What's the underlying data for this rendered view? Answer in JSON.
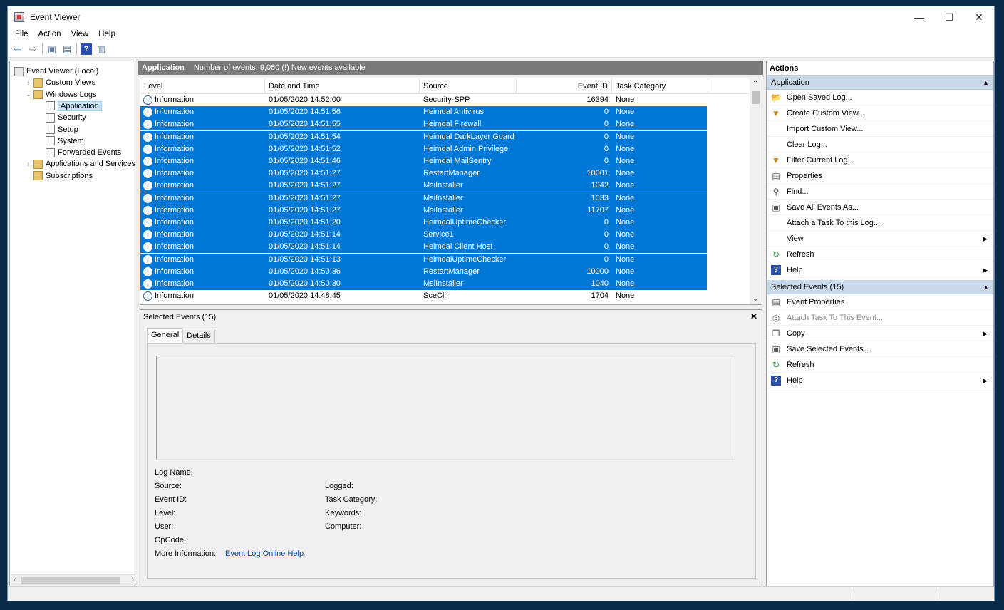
{
  "window": {
    "title": "Event Viewer",
    "controls": {
      "minimize": "—",
      "maximize": "☐",
      "close": "✕"
    }
  },
  "menu": [
    "File",
    "Action",
    "View",
    "Help"
  ],
  "toolbar": {
    "buttons": [
      {
        "name": "back-icon",
        "glyph": "⇦"
      },
      {
        "name": "forward-icon",
        "glyph": "⇨"
      },
      {
        "name": "up-folder-icon",
        "glyph": "▣"
      },
      {
        "name": "show-hide-tree-icon",
        "glyph": "▤"
      },
      {
        "name": "help-icon",
        "glyph": "?"
      },
      {
        "name": "show-hide-action-pane-icon",
        "glyph": "▥"
      }
    ]
  },
  "tree": {
    "items": [
      {
        "label": "Event Viewer (Local)",
        "indent": 0,
        "expander": "",
        "icon": "root"
      },
      {
        "label": "Custom Views",
        "indent": 1,
        "expander": "›",
        "icon": "folder"
      },
      {
        "label": "Windows Logs",
        "indent": 1,
        "expander": "⌄",
        "icon": "folder"
      },
      {
        "label": "Application",
        "indent": 2,
        "expander": "",
        "icon": "log",
        "selected": true
      },
      {
        "label": "Security",
        "indent": 2,
        "expander": "",
        "icon": "log"
      },
      {
        "label": "Setup",
        "indent": 2,
        "expander": "",
        "icon": "log"
      },
      {
        "label": "System",
        "indent": 2,
        "expander": "",
        "icon": "log"
      },
      {
        "label": "Forwarded Events",
        "indent": 2,
        "expander": "",
        "icon": "log"
      },
      {
        "label": "Applications and Services Lo",
        "indent": 1,
        "expander": "›",
        "icon": "folder"
      },
      {
        "label": "Subscriptions",
        "indent": 1,
        "expander": "",
        "icon": "folder"
      }
    ]
  },
  "center": {
    "log_name": "Application",
    "summary": "Number of events: 9,060 (!) New events available"
  },
  "grid": {
    "columns": [
      "Level",
      "Date and Time",
      "Source",
      "Event ID",
      "Task Category"
    ],
    "rows": [
      {
        "level": "Information",
        "date": "01/05/2020 14:52:00",
        "source": "Security-SPP",
        "id": "16394",
        "cat": "None",
        "selected": false
      },
      {
        "level": "Information",
        "date": "01/05/2020 14:51:56",
        "source": "Heimdal Antivirus",
        "id": "0",
        "cat": "None",
        "selected": true
      },
      {
        "level": "Information",
        "date": "01/05/2020 14:51:55",
        "source": "Heimdal Firewall",
        "id": "0",
        "cat": "None",
        "selected": true
      },
      {
        "level": "Information",
        "date": "01/05/2020 14:51:54",
        "source": "Heimdal DarkLayer Guard",
        "id": "0",
        "cat": "None",
        "selected": true
      },
      {
        "level": "Information",
        "date": "01/05/2020 14:51:52",
        "source": "Heimdal Admin Privilege",
        "id": "0",
        "cat": "None",
        "selected": true
      },
      {
        "level": "Information",
        "date": "01/05/2020 14:51:46",
        "source": "Heimdal MailSentry",
        "id": "0",
        "cat": "None",
        "selected": true
      },
      {
        "level": "Information",
        "date": "01/05/2020 14:51:27",
        "source": "RestartManager",
        "id": "10001",
        "cat": "None",
        "selected": true
      },
      {
        "level": "Information",
        "date": "01/05/2020 14:51:27",
        "source": "MsiInstaller",
        "id": "1042",
        "cat": "None",
        "selected": true
      },
      {
        "level": "Information",
        "date": "01/05/2020 14:51:27",
        "source": "MsiInstaller",
        "id": "1033",
        "cat": "None",
        "selected": true
      },
      {
        "level": "Information",
        "date": "01/05/2020 14:51:27",
        "source": "MsiInstaller",
        "id": "11707",
        "cat": "None",
        "selected": true
      },
      {
        "level": "Information",
        "date": "01/05/2020 14:51:20",
        "source": "HeimdalUptimeChecker",
        "id": "0",
        "cat": "None",
        "selected": true
      },
      {
        "level": "Information",
        "date": "01/05/2020 14:51:14",
        "source": "Service1",
        "id": "0",
        "cat": "None",
        "selected": true
      },
      {
        "level": "Information",
        "date": "01/05/2020 14:51:14",
        "source": "Heimdal Client Host",
        "id": "0",
        "cat": "None",
        "selected": true
      },
      {
        "level": "Information",
        "date": "01/05/2020 14:51:13",
        "source": "HeimdalUptimeChecker",
        "id": "0",
        "cat": "None",
        "selected": true
      },
      {
        "level": "Information",
        "date": "01/05/2020 14:50:36",
        "source": "RestartManager",
        "id": "10000",
        "cat": "None",
        "selected": true
      },
      {
        "level": "Information",
        "date": "01/05/2020 14:50:30",
        "source": "MsiInstaller",
        "id": "1040",
        "cat": "None",
        "selected": true
      },
      {
        "level": "Information",
        "date": "01/05/2020 14:48:45",
        "source": "SceCli",
        "id": "1704",
        "cat": "None",
        "selected": false
      }
    ]
  },
  "detail": {
    "title": "Selected Events (15)",
    "close": "✕",
    "tabs": [
      "General",
      "Details"
    ],
    "left_fields": [
      "Log Name:",
      "Source:",
      "Event ID:",
      "Level:",
      "User:",
      "OpCode:",
      "More Information:"
    ],
    "right_fields": [
      "Logged:",
      "Task Category:",
      "Keywords:",
      "Computer:"
    ],
    "more_info_link": "Event Log Online Help"
  },
  "actions": {
    "title": "Actions",
    "sections": [
      {
        "title": "Application",
        "items": [
          {
            "label": "Open Saved Log...",
            "icon": "open-folder-icon",
            "glyph": "📂",
            "submenu": false
          },
          {
            "label": "Create Custom View...",
            "icon": "filter-icon",
            "glyph": "▼",
            "submenu": false
          },
          {
            "label": "Import Custom View...",
            "icon": "",
            "glyph": "",
            "submenu": false
          },
          {
            "label": "Clear Log...",
            "icon": "",
            "glyph": "",
            "submenu": false
          },
          {
            "label": "Filter Current Log...",
            "icon": "filter-icon",
            "glyph": "▼",
            "submenu": false
          },
          {
            "label": "Properties",
            "icon": "properties-icon",
            "glyph": "▤",
            "submenu": false
          },
          {
            "label": "Find...",
            "icon": "binoculars-icon",
            "glyph": "⚲",
            "submenu": false
          },
          {
            "label": "Save All Events As...",
            "icon": "save-icon",
            "glyph": "▣",
            "submenu": false
          },
          {
            "label": "Attach a Task To this Log...",
            "icon": "",
            "glyph": "",
            "submenu": false
          },
          {
            "label": "View",
            "icon": "",
            "glyph": "",
            "submenu": true
          },
          {
            "label": "Refresh",
            "icon": "refresh-icon",
            "glyph": "↻",
            "submenu": false
          },
          {
            "label": "Help",
            "icon": "help-icon",
            "glyph": "?",
            "submenu": true
          }
        ]
      },
      {
        "title": "Selected Events (15)",
        "items": [
          {
            "label": "Event Properties",
            "icon": "properties-icon",
            "glyph": "▤",
            "submenu": false
          },
          {
            "label": "Attach Task To This Event...",
            "icon": "task-icon",
            "glyph": "◎",
            "submenu": false,
            "disabled": true
          },
          {
            "label": "Copy",
            "icon": "copy-icon",
            "glyph": "❐",
            "submenu": true
          },
          {
            "label": "Save Selected Events...",
            "icon": "save-icon",
            "glyph": "▣",
            "submenu": false
          },
          {
            "label": "Refresh",
            "icon": "refresh-icon",
            "glyph": "↻",
            "submenu": false
          },
          {
            "label": "Help",
            "icon": "help-icon",
            "glyph": "?",
            "submenu": true
          }
        ]
      }
    ]
  },
  "colors": {
    "selection": "#0078d7",
    "section_header": "#c9d9ea",
    "center_header": "#7a7a7a",
    "link": "#0645ad"
  }
}
